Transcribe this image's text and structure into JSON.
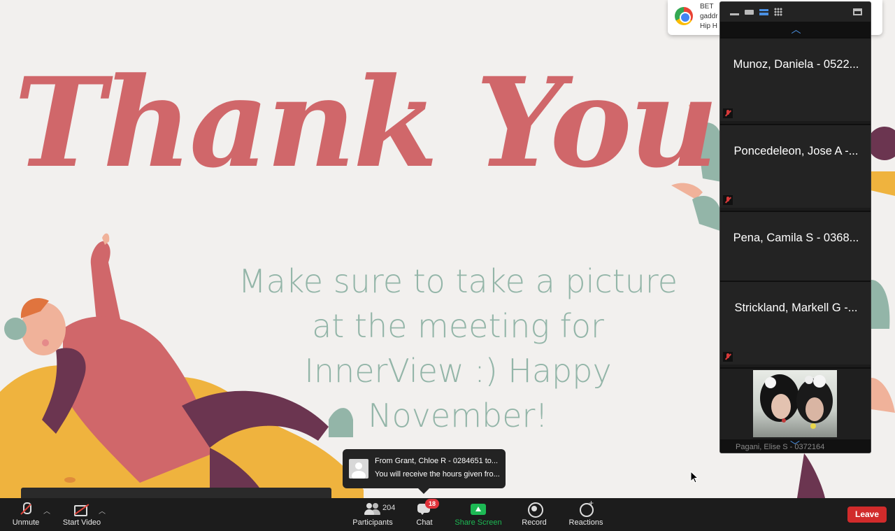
{
  "slide": {
    "title": "Thank You!",
    "message_lines": [
      "Make sure to take a picture",
      "at the meeting for",
      "InnerView :) Happy",
      "November!"
    ]
  },
  "notification": {
    "line1": "BET",
    "line2": "gaddr",
    "line3": "Hip H"
  },
  "gallery": {
    "tiles": [
      {
        "name": "Munoz, Daniela - 0522..."
      },
      {
        "name": "Poncedeleon, Jose A -..."
      },
      {
        "name": "Pena, Camila S - 0368..."
      },
      {
        "name": "Strickland, Markell G -..."
      }
    ],
    "video_tile_name": "Pagani, Elise S - 0372164"
  },
  "chat_toast": {
    "from": "From Grant, Chloe R - 0284651 to...",
    "message": "You will receive the hours given fro..."
  },
  "controls": {
    "unmute_label": "Unmute",
    "start_video_label": "Start Video",
    "participants_label": "Participants",
    "participants_count": "204",
    "chat_label": "Chat",
    "chat_badge": "18",
    "share_label": "Share Screen",
    "record_label": "Record",
    "reactions_label": "Reactions",
    "leave_label": "Leave"
  },
  "colors": {
    "title": "#d0676a",
    "message": "#93b5a8",
    "share_screen": "#1db954",
    "leave": "#d12b2b",
    "badge": "#e0323a"
  }
}
